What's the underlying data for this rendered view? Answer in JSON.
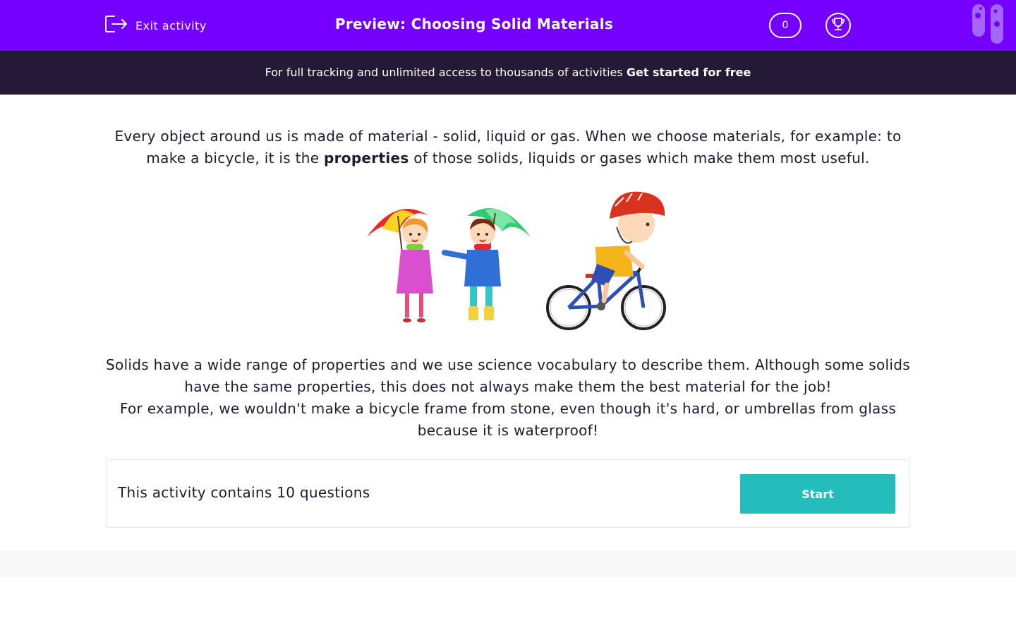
{
  "header": {
    "exit_label": "Exit activity",
    "title": "Preview: Choosing Solid Materials",
    "score": "0",
    "icons": {
      "exit": "exit-door-icon",
      "trophy": "trophy-icon",
      "logo": "brand-logo"
    },
    "accent_color": "#7400ff"
  },
  "promo": {
    "text": "For full tracking and unlimited access to thousands of activities",
    "cta": "Get started for free",
    "background": "#231b35"
  },
  "intro": {
    "part1": "Every object around us is made of material - solid, liquid or gas. When we choose materials, for example: to make a bicycle, it is the",
    "bold": "properties",
    "part2": "of those solids, liquids or gases which make them most useful."
  },
  "illustration": {
    "items": [
      "children-with-umbrellas",
      "child-riding-bicycle"
    ]
  },
  "description": {
    "line1": "Solids have a wide range of properties and we use science vocabulary to describe them. Although some solids have the same properties, this does not always make them the best material for the job!",
    "line2": "For example, we wouldn't make a bicycle frame from stone, even though it's hard, or umbrellas from glass because it is waterproof!"
  },
  "activity": {
    "summary": "This activity contains 10 questions",
    "start_label": "Start",
    "button_color": "#25bcbc"
  }
}
